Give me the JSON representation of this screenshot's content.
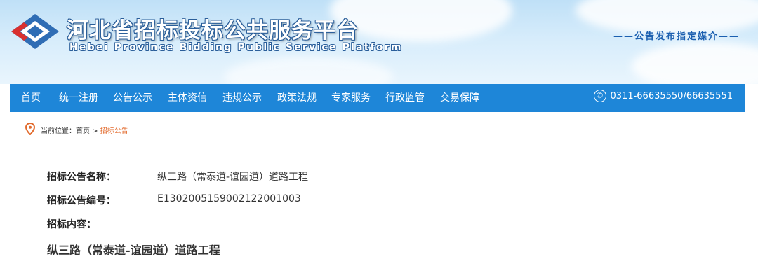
{
  "header": {
    "title": "河北省招标投标公共服务平台",
    "subtitle": "Hebei Province Bidding Public Service Platform",
    "slogan": "——公告发布指定媒介——"
  },
  "nav": {
    "items": [
      "首页",
      "统一注册",
      "公告公示",
      "主体资信",
      "违规公示",
      "政策法规",
      "专家服务",
      "行政监管",
      "交易保障"
    ],
    "phone": "0311-66635550/66635551"
  },
  "breadcrumb": {
    "prefix": "当前位置：",
    "home": "首页",
    "separator": " > ",
    "current": "招标公告"
  },
  "notice": {
    "name_label": "招标公告名称：",
    "name_value": "纵三路（常泰道-谊园道）道路工程",
    "code_label": "招标公告编号：",
    "code_value": "E1302005159002122001003",
    "content_label": "招标内容：",
    "content_link": "纵三路（常泰道-谊园道）道路工程"
  },
  "colors": {
    "nav_bg": "#1e86d8",
    "brand_blue": "#1b5fb0",
    "breadcrumb_current": "#e26a2c"
  }
}
